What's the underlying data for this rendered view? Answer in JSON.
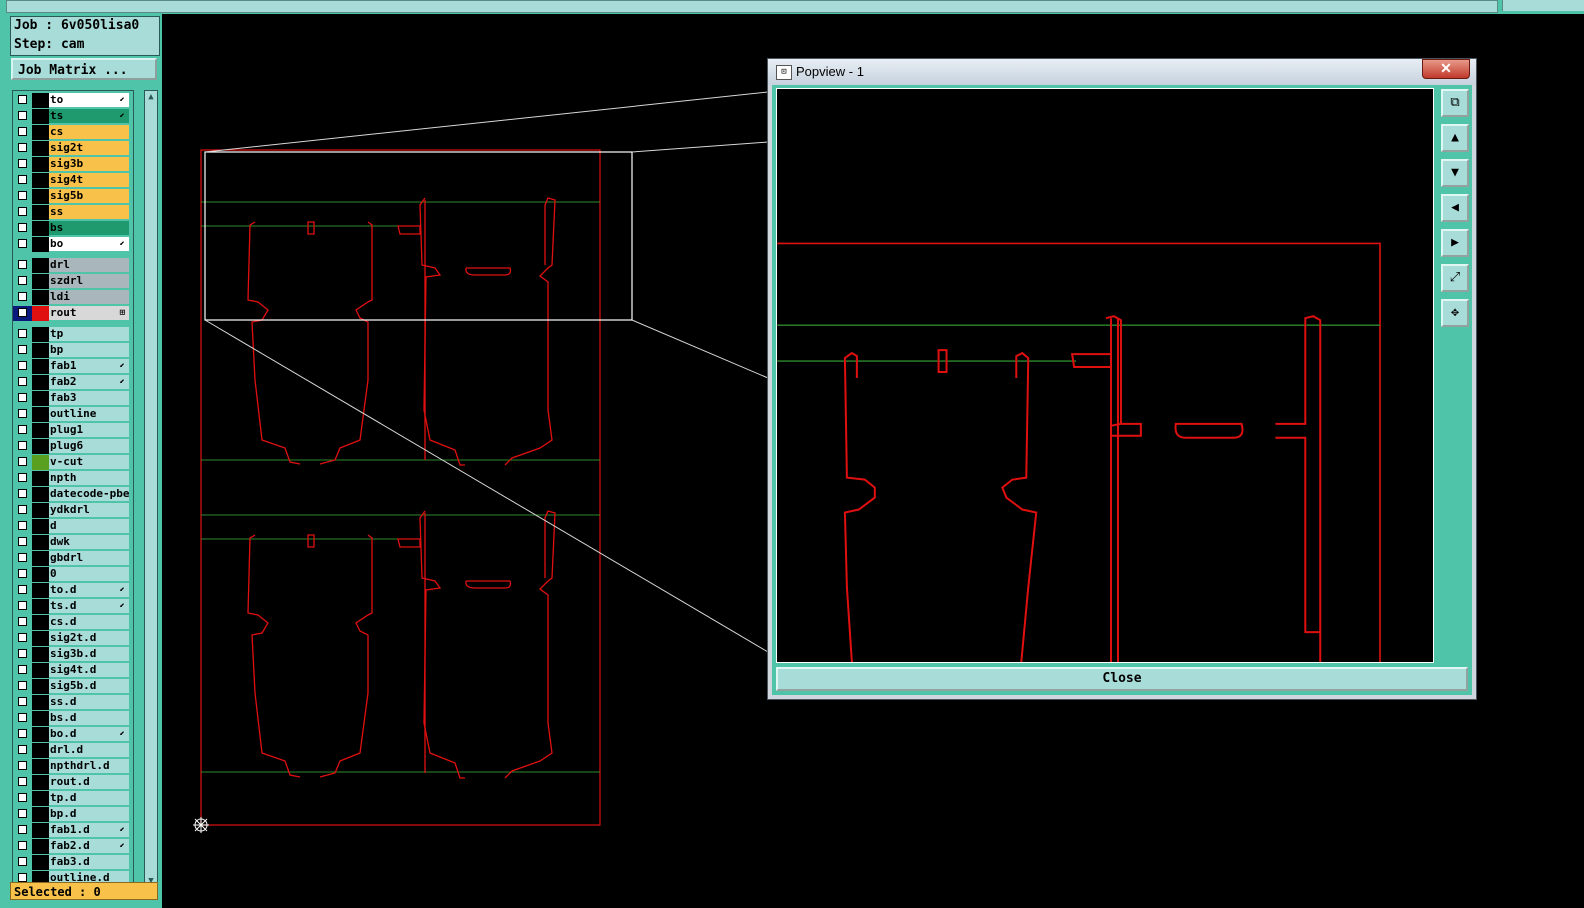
{
  "job": {
    "label": "Job : 6v050lisa0",
    "step": "Step: cam"
  },
  "job_matrix_button": "Job Matrix ...",
  "layers": [
    {
      "name": "to",
      "bg": "#ffffff",
      "flag": "⬋"
    },
    {
      "name": "ts",
      "bg": "#1f9a6e",
      "flag": "⬋"
    },
    {
      "name": "cs",
      "bg": "#f7c14a",
      "flag": ""
    },
    {
      "name": "sig2t",
      "bg": "#f7c14a",
      "flag": ""
    },
    {
      "name": "sig3b",
      "bg": "#f7c14a",
      "flag": ""
    },
    {
      "name": "sig4t",
      "bg": "#f7c14a",
      "flag": ""
    },
    {
      "name": "sig5b",
      "bg": "#f7c14a",
      "flag": ""
    },
    {
      "name": "ss",
      "bg": "#f7c14a",
      "flag": ""
    },
    {
      "name": "bs",
      "bg": "#1f9a6e",
      "flag": ""
    },
    {
      "name": "bo",
      "bg": "#ffffff",
      "flag": "⬋"
    },
    {
      "name": "drl",
      "bg": "#a9b7bc",
      "flag": ""
    },
    {
      "name": "szdrl",
      "bg": "#a9b7bc",
      "flag": ""
    },
    {
      "name": "ldi",
      "bg": "#a9b7bc",
      "flag": ""
    },
    {
      "name": "rout",
      "bg": "#d8d8d8",
      "flag": "⊞",
      "active": true
    },
    {
      "name": "tp",
      "bg": "#a8dcd8",
      "flag": ""
    },
    {
      "name": "bp",
      "bg": "#a8dcd8",
      "flag": ""
    },
    {
      "name": "fab1",
      "bg": "#a8dcd8",
      "flag": "⬋"
    },
    {
      "name": "fab2",
      "bg": "#a8dcd8",
      "flag": "⬋"
    },
    {
      "name": "fab3",
      "bg": "#a8dcd8",
      "flag": ""
    },
    {
      "name": "outline",
      "bg": "#a8dcd8",
      "flag": ""
    },
    {
      "name": "plug1",
      "bg": "#a8dcd8",
      "flag": ""
    },
    {
      "name": "plug6",
      "bg": "#a8dcd8",
      "flag": ""
    },
    {
      "name": "v-cut",
      "bg": "#a8dcd8",
      "flag": "",
      "swatch": "#5aa020"
    },
    {
      "name": "npth",
      "bg": "#a8dcd8",
      "flag": ""
    },
    {
      "name": "datecode-pbe",
      "bg": "#a8dcd8",
      "flag": ""
    },
    {
      "name": "ydkdrl",
      "bg": "#a8dcd8",
      "flag": ""
    },
    {
      "name": "d",
      "bg": "#a8dcd8",
      "flag": ""
    },
    {
      "name": "dwk",
      "bg": "#a8dcd8",
      "flag": ""
    },
    {
      "name": "gbdrl",
      "bg": "#a8dcd8",
      "flag": ""
    },
    {
      "name": "0",
      "bg": "#a8dcd8",
      "flag": ""
    },
    {
      "name": "to.d",
      "bg": "#a8dcd8",
      "flag": "⬋"
    },
    {
      "name": "ts.d",
      "bg": "#a8dcd8",
      "flag": "⬋"
    },
    {
      "name": "cs.d",
      "bg": "#a8dcd8",
      "flag": ""
    },
    {
      "name": "sig2t.d",
      "bg": "#a8dcd8",
      "flag": ""
    },
    {
      "name": "sig3b.d",
      "bg": "#a8dcd8",
      "flag": ""
    },
    {
      "name": "sig4t.d",
      "bg": "#a8dcd8",
      "flag": ""
    },
    {
      "name": "sig5b.d",
      "bg": "#a8dcd8",
      "flag": ""
    },
    {
      "name": "ss.d",
      "bg": "#a8dcd8",
      "flag": ""
    },
    {
      "name": "bs.d",
      "bg": "#a8dcd8",
      "flag": ""
    },
    {
      "name": "bo.d",
      "bg": "#a8dcd8",
      "flag": "⬋"
    },
    {
      "name": "drl.d",
      "bg": "#a8dcd8",
      "flag": ""
    },
    {
      "name": "npthdrl.d",
      "bg": "#a8dcd8",
      "flag": ""
    },
    {
      "name": "rout.d",
      "bg": "#a8dcd8",
      "flag": ""
    },
    {
      "name": "tp.d",
      "bg": "#a8dcd8",
      "flag": ""
    },
    {
      "name": "bp.d",
      "bg": "#a8dcd8",
      "flag": ""
    },
    {
      "name": "fab1.d",
      "bg": "#a8dcd8",
      "flag": "⬋"
    },
    {
      "name": "fab2.d",
      "bg": "#a8dcd8",
      "flag": "⬋"
    },
    {
      "name": "fab3.d",
      "bg": "#a8dcd8",
      "flag": ""
    },
    {
      "name": "outline.d",
      "bg": "#a8dcd8",
      "flag": ""
    }
  ],
  "selected_label": "Selected : 0",
  "popview": {
    "title": "Popview - 1",
    "close_x": "✕",
    "close_button": "Close",
    "tools": [
      {
        "name": "zoom-window-icon",
        "glyph": "⧉"
      },
      {
        "name": "pan-up-icon",
        "glyph": "▲"
      },
      {
        "name": "pan-down-icon",
        "glyph": "▼"
      },
      {
        "name": "pan-left-icon",
        "glyph": "◀"
      },
      {
        "name": "pan-right-icon",
        "glyph": "▶"
      },
      {
        "name": "zoom-out-icon",
        "glyph": "⤢"
      },
      {
        "name": "zoom-fit-icon",
        "glyph": "✥"
      }
    ]
  },
  "colors": {
    "rout": "#e01010",
    "vcut": "#2e8a2e",
    "panel": "#4fc4a8",
    "zoom_frame": "#ffffff"
  }
}
